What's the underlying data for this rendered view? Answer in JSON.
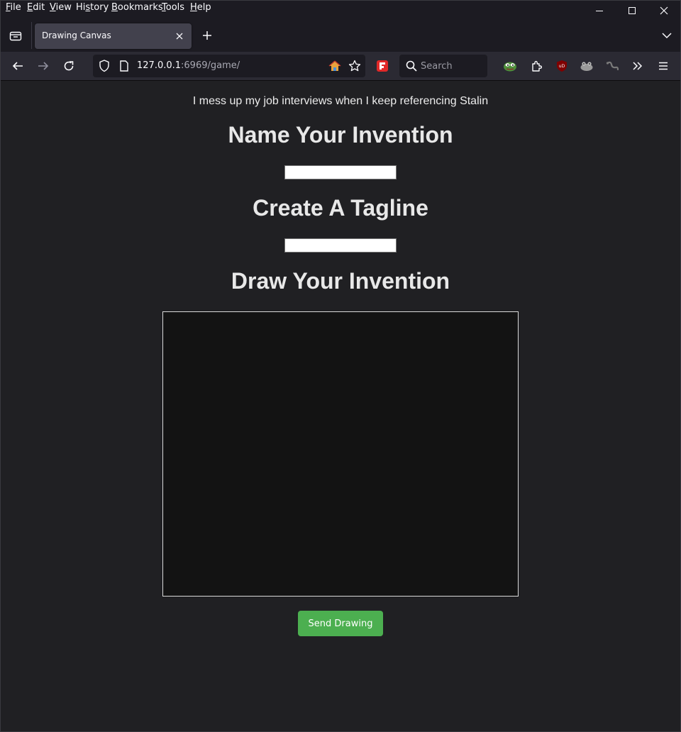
{
  "menubar": {
    "items": [
      {
        "first": "F",
        "rest": "ile"
      },
      {
        "first": "E",
        "rest": "dit"
      },
      {
        "first": "V",
        "rest": "iew"
      },
      {
        "pre": "Hi",
        "first": "s",
        "rest": "tory"
      },
      {
        "first": "B",
        "rest": "ookmarks"
      },
      {
        "first": "T",
        "rest": "ools"
      },
      {
        "first": "H",
        "rest": "elp"
      }
    ]
  },
  "tabs": [
    {
      "title": "Drawing Canvas",
      "active": true
    }
  ],
  "navbar": {
    "url_host": "127.0.0.1",
    "url_rest": ":6969/game/",
    "search_placeholder": "Search"
  },
  "page": {
    "quote": "I mess up my job interviews when I keep referencing Stalin",
    "name_heading": "Name Your Invention",
    "name_value": "",
    "tagline_heading": "Create A Tagline",
    "tagline_value": "",
    "draw_heading": "Draw Your Invention",
    "send_label": "Send Drawing"
  },
  "colors": {
    "page_bg": "#202023",
    "canvas_bg": "#131313",
    "send_button": "#4caf50",
    "chrome_bg": "#1c1b22",
    "toolbar_bg": "#2b2a33"
  },
  "icons": [
    "tab-list-icon",
    "close-icon",
    "plus-icon",
    "chevron-down-icon",
    "back-icon",
    "forward-icon",
    "reload-icon",
    "shield-icon",
    "page-icon",
    "home-icon",
    "star-icon",
    "flipboard-icon",
    "search-icon",
    "pepe-icon",
    "extensions-icon",
    "ublock-icon",
    "frog-icon",
    "snake-icon",
    "overflow-icon",
    "hamburger-icon"
  ]
}
